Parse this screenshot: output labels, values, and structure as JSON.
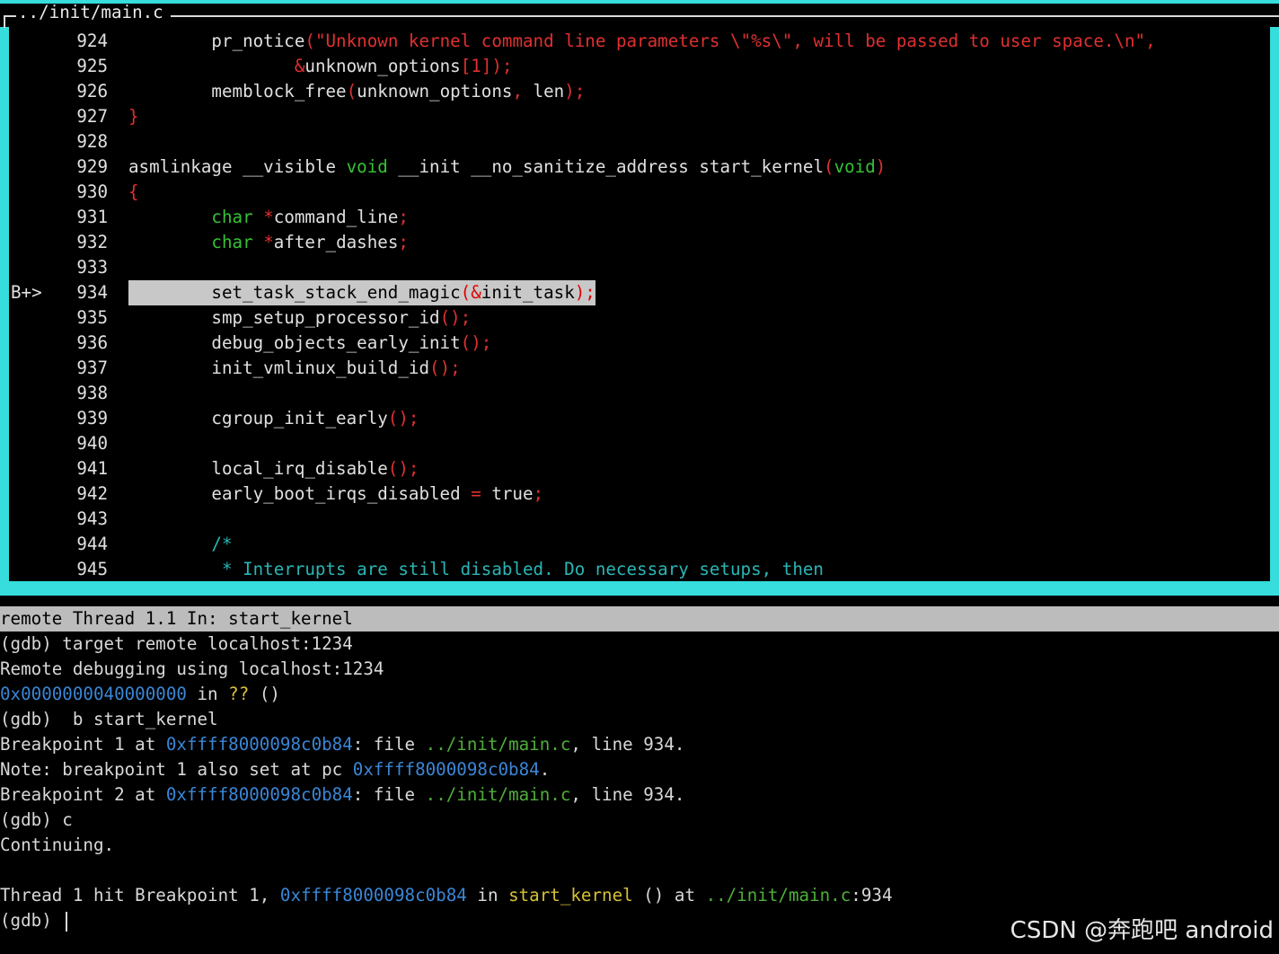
{
  "source_window": {
    "title": "../init/main.c",
    "breakpoint_marker": "B+>",
    "lines": [
      {
        "num": "924",
        "segments": [
          [
            "        pr_notice",
            ""
          ],
          [
            "(",
            "p"
          ],
          [
            "\"Unknown kernel command line parameters \\\"%s\\\", will be passed to user space.\\n\",",
            "s"
          ]
        ]
      },
      {
        "num": "925",
        "segments": [
          [
            "                ",
            ""
          ],
          [
            "&",
            "p"
          ],
          [
            "unknown_options",
            ""
          ],
          [
            "[",
            "p"
          ],
          [
            "1",
            "n"
          ],
          [
            "]);",
            "p"
          ]
        ]
      },
      {
        "num": "926",
        "segments": [
          [
            "        memblock_free",
            ""
          ],
          [
            "(",
            "p"
          ],
          [
            "unknown_options",
            ""
          ],
          [
            ",",
            "p"
          ],
          [
            " len",
            ""
          ],
          [
            ");",
            "p"
          ]
        ]
      },
      {
        "num": "927",
        "segments": [
          [
            "}",
            "p"
          ]
        ]
      },
      {
        "num": "928",
        "segments": []
      },
      {
        "num": "929",
        "segments": [
          [
            "asmlinkage __visible ",
            ""
          ],
          [
            "void",
            "k"
          ],
          [
            " __init __no_sanitize_address start_kernel",
            ""
          ],
          [
            "(",
            "p"
          ],
          [
            "void",
            "k"
          ],
          [
            ")",
            "p"
          ]
        ]
      },
      {
        "num": "930",
        "segments": [
          [
            "{",
            "p"
          ]
        ]
      },
      {
        "num": "931",
        "segments": [
          [
            "        ",
            ""
          ],
          [
            "char",
            "k"
          ],
          [
            " ",
            ""
          ],
          [
            "*",
            "p"
          ],
          [
            "command_line",
            ""
          ],
          [
            ";",
            "p"
          ]
        ]
      },
      {
        "num": "932",
        "segments": [
          [
            "        ",
            ""
          ],
          [
            "char",
            "k"
          ],
          [
            " ",
            ""
          ],
          [
            "*",
            "p"
          ],
          [
            "after_dashes",
            ""
          ],
          [
            ";",
            "p"
          ]
        ]
      },
      {
        "num": "933",
        "segments": []
      },
      {
        "num": "934",
        "segments": [
          [
            "        set_task_stack_end_magic",
            ""
          ],
          [
            "(&",
            "p"
          ],
          [
            "init_task",
            ""
          ],
          [
            ");",
            "p"
          ]
        ],
        "highlight": true,
        "breakpoint": true
      },
      {
        "num": "935",
        "segments": [
          [
            "        smp_setup_processor_id",
            ""
          ],
          [
            "();",
            "p"
          ]
        ]
      },
      {
        "num": "936",
        "segments": [
          [
            "        debug_objects_early_init",
            ""
          ],
          [
            "();",
            "p"
          ]
        ]
      },
      {
        "num": "937",
        "segments": [
          [
            "        init_vmlinux_build_id",
            ""
          ],
          [
            "();",
            "p"
          ]
        ]
      },
      {
        "num": "938",
        "segments": []
      },
      {
        "num": "939",
        "segments": [
          [
            "        cgroup_init_early",
            ""
          ],
          [
            "();",
            "p"
          ]
        ]
      },
      {
        "num": "940",
        "segments": []
      },
      {
        "num": "941",
        "segments": [
          [
            "        local_irq_disable",
            ""
          ],
          [
            "();",
            "p"
          ]
        ]
      },
      {
        "num": "942",
        "segments": [
          [
            "        early_boot_irqs_disabled ",
            ""
          ],
          [
            "=",
            "p"
          ],
          [
            " true",
            ""
          ],
          [
            ";",
            "p"
          ]
        ]
      },
      {
        "num": "943",
        "segments": []
      },
      {
        "num": "944",
        "segments": [
          [
            "        /*",
            "c"
          ]
        ]
      },
      {
        "num": "945",
        "segments": [
          [
            "         * Interrupts are still disabled. Do necessary setups, then",
            "c"
          ]
        ]
      }
    ]
  },
  "status_bar": {
    "text": "remote Thread 1.1 In: start_kernel"
  },
  "console": {
    "lines": [
      [
        [
          "(gdb) target remote localhost:1234",
          ""
        ]
      ],
      [
        [
          "Remote debugging using localhost:1234",
          ""
        ]
      ],
      [
        [
          "0x0000000040000000",
          "addr"
        ],
        [
          " in ",
          ""
        ],
        [
          "??",
          "q"
        ],
        [
          " ()",
          ""
        ]
      ],
      [
        [
          "(gdb)  b start_kernel",
          ""
        ]
      ],
      [
        [
          "Breakpoint 1 at ",
          ""
        ],
        [
          "0xffff8000098c0b84",
          "addr"
        ],
        [
          ": file ",
          ""
        ],
        [
          "../init/main.c",
          "file"
        ],
        [
          ", line 934.",
          ""
        ]
      ],
      [
        [
          "Note: breakpoint 1 also set at pc ",
          ""
        ],
        [
          "0xffff8000098c0b84",
          "addr"
        ],
        [
          ".",
          ""
        ]
      ],
      [
        [
          "Breakpoint 2 at ",
          ""
        ],
        [
          "0xffff8000098c0b84",
          "addr"
        ],
        [
          ": file ",
          ""
        ],
        [
          "../init/main.c",
          "file"
        ],
        [
          ", line 934.",
          ""
        ]
      ],
      [
        [
          "(gdb) c",
          ""
        ]
      ],
      [
        [
          "Continuing.",
          ""
        ]
      ],
      [],
      [
        [
          "Thread 1 hit Breakpoint 1, ",
          ""
        ],
        [
          "0xffff8000098c0b84",
          "addr"
        ],
        [
          " in ",
          ""
        ],
        [
          "start_kernel",
          "func"
        ],
        [
          " () at ",
          ""
        ],
        [
          "../init/main.c",
          "file"
        ],
        [
          ":934",
          ""
        ]
      ],
      [
        [
          "(gdb) ",
          ""
        ]
      ]
    ],
    "prompt_has_cursor": true
  },
  "watermark": "CSDN @奔跑吧 android",
  "colors": {
    "frame": "#37dcdc",
    "status_bg": "#bcbcbc",
    "highlight_bg": "#c8c8c8",
    "keyword": "#36c236",
    "punct_string": "#e03030",
    "comment": "#2bb5b5",
    "address": "#3a86d6",
    "file": "#4fae3a",
    "function": "#d6c035"
  }
}
